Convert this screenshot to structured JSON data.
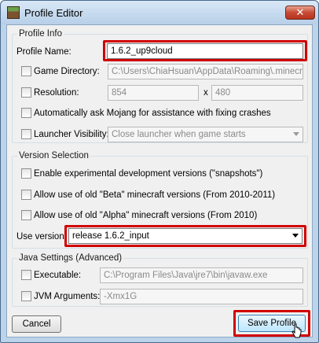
{
  "window": {
    "title": "Profile Editor",
    "close_label": "✕"
  },
  "profile_info": {
    "section_label": "Profile Info",
    "profile_name_label": "Profile Name:",
    "profile_name_value": "1.6.2_up9cloud",
    "game_directory_label": "Game Directory:",
    "game_directory_value": "C:\\Users\\ChiaHsuan\\AppData\\Roaming\\.minecraft",
    "resolution_label": "Resolution:",
    "resolution_width": "854",
    "resolution_x": "x",
    "resolution_height": "480",
    "auto_ask_label": "Automatically ask Mojang for assistance with fixing crashes",
    "launcher_visibility_label": "Launcher Visibility:",
    "launcher_visibility_value": "Close launcher when game starts"
  },
  "version_selection": {
    "section_label": "Version Selection",
    "snapshots_label": "Enable experimental development versions (\"snapshots\")",
    "beta_label": "Allow use of old \"Beta\" minecraft versions (From 2010-2011)",
    "alpha_label": "Allow use of old \"Alpha\" minecraft versions (From 2010)",
    "use_version_label": "Use version:",
    "use_version_value": "release 1.6.2_input"
  },
  "java_settings": {
    "section_label": "Java Settings (Advanced)",
    "executable_label": "Executable:",
    "executable_value": "C:\\Program Files\\Java\\jre7\\bin\\javaw.exe",
    "jvm_label": "JVM Arguments:",
    "jvm_value": "-Xmx1G"
  },
  "footer": {
    "cancel_label": "Cancel",
    "save_label": "Save Profile"
  },
  "colors": {
    "highlight": "#d10000",
    "window_frame": "#bcd3ea"
  }
}
